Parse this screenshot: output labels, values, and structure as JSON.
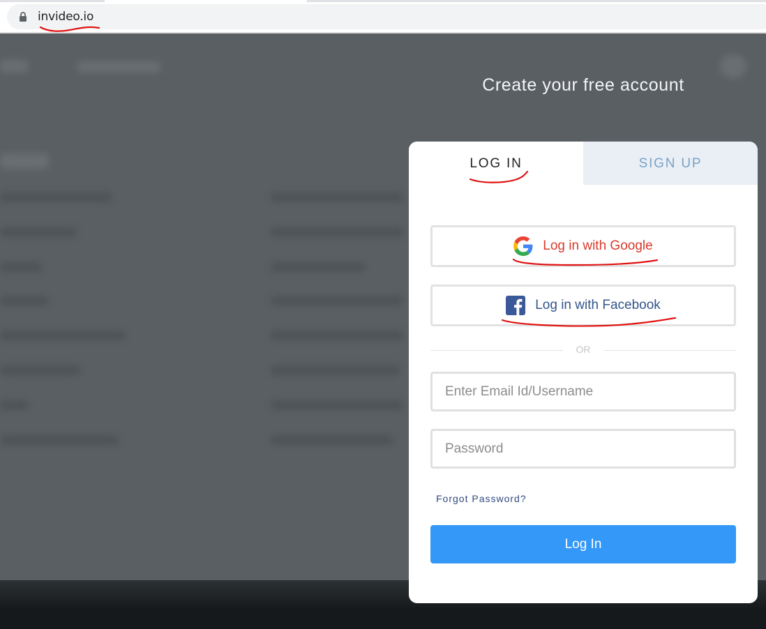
{
  "browser": {
    "url": "invideo.io"
  },
  "modal": {
    "heading": "Create your free account",
    "tabs": {
      "login": "LOG IN",
      "signup": "SIGN UP"
    },
    "google_button": "Log in with Google",
    "facebook_button": "Log in with Facebook",
    "divider": "OR",
    "email_placeholder": "Enter Email Id/Username",
    "password_placeholder": "Password",
    "forgot_password": "Forgot Password?",
    "submit": "Log In"
  },
  "colors": {
    "accent_blue": "#3398f7",
    "google_red": "#d93a2b",
    "facebook_blue": "#34558b",
    "annotation_red": "#e01010"
  }
}
